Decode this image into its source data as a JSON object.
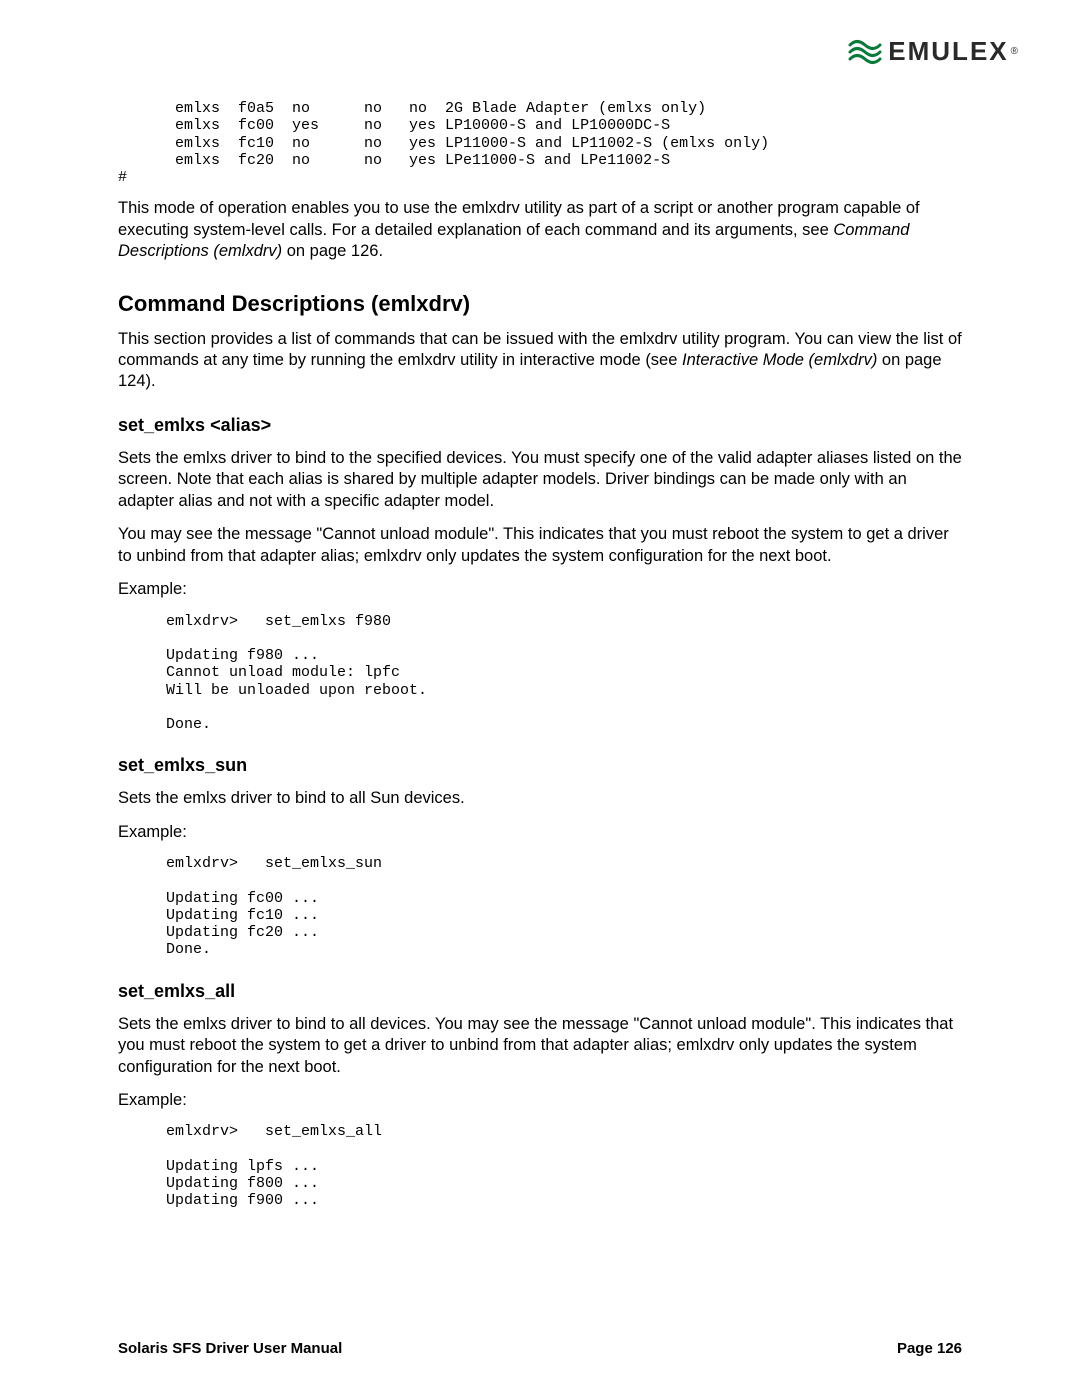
{
  "logo": {
    "text": "EMULEX"
  },
  "top_code": " emlxs  f0a5  no      no   no  2G Blade Adapter (emlxs only)\n emlxs  fc00  yes     no   yes LP10000-S and LP10000DC-S\n emlxs  fc10  no      no   yes LP11000-S and LP11002-S (emlxs only)\n emlxs  fc20  no      no   yes LPe11000-S and LPe11002-S",
  "hash": "#",
  "intro1a": "This mode of operation enables you to use the emlxdrv utility as part of a script or another program capable of executing system-level calls. For a detailed explanation of each command and its arguments, see ",
  "intro1b": "Command Descriptions (emlxdrv)",
  "intro1c": " on page 126.",
  "h1": "Command Descriptions (emlxdrv)",
  "cmd_intro_a": "This section provides a list of commands that can be issued with the emlxdrv utility program. You can view the list of commands at any time by running the emlxdrv utility in interactive mode (see ",
  "cmd_intro_b": "Interactive Mode (emlxdrv)",
  "cmd_intro_c": " on page 124).",
  "set_emlxs": {
    "title": "set_emlxs <alias>",
    "p1": "Sets the emlxs driver to bind to the specified devices. You must specify one of the valid adapter aliases listed on the screen. Note that each alias is shared by multiple adapter models. Driver bindings can be made only with an adapter alias and not with a specific adapter model.",
    "p2": "You may see the message \"Cannot unload module\". This indicates that you must reboot the system to get a driver to unbind from that adapter alias; emlxdrv only updates the system configuration for the next boot.",
    "example_label": "Example:",
    "code": "emlxdrv>   set_emlxs f980\n\nUpdating f980 ...\nCannot unload module: lpfc\nWill be unloaded upon reboot.\n\nDone."
  },
  "set_emlxs_sun": {
    "title": "set_emlxs_sun",
    "p1": "Sets the emlxs driver to bind to all Sun devices.",
    "example_label": "Example:",
    "code": "emlxdrv>   set_emlxs_sun\n\nUpdating fc00 ...\nUpdating fc10 ...\nUpdating fc20 ...\nDone."
  },
  "set_emlxs_all": {
    "title": "set_emlxs_all",
    "p1": "Sets the emlxs driver to bind to all devices. You may see the message \"Cannot unload module\". This indicates that you must reboot the system to get a driver to unbind from that adapter alias; emlxdrv only updates the system configuration for the next boot.",
    "example_label": "Example:",
    "code": "emlxdrv>   set_emlxs_all\n\nUpdating lpfs ...\nUpdating f800 ...\nUpdating f900 ..."
  },
  "footer": {
    "left": "Solaris SFS Driver User Manual",
    "right": "Page 126"
  }
}
